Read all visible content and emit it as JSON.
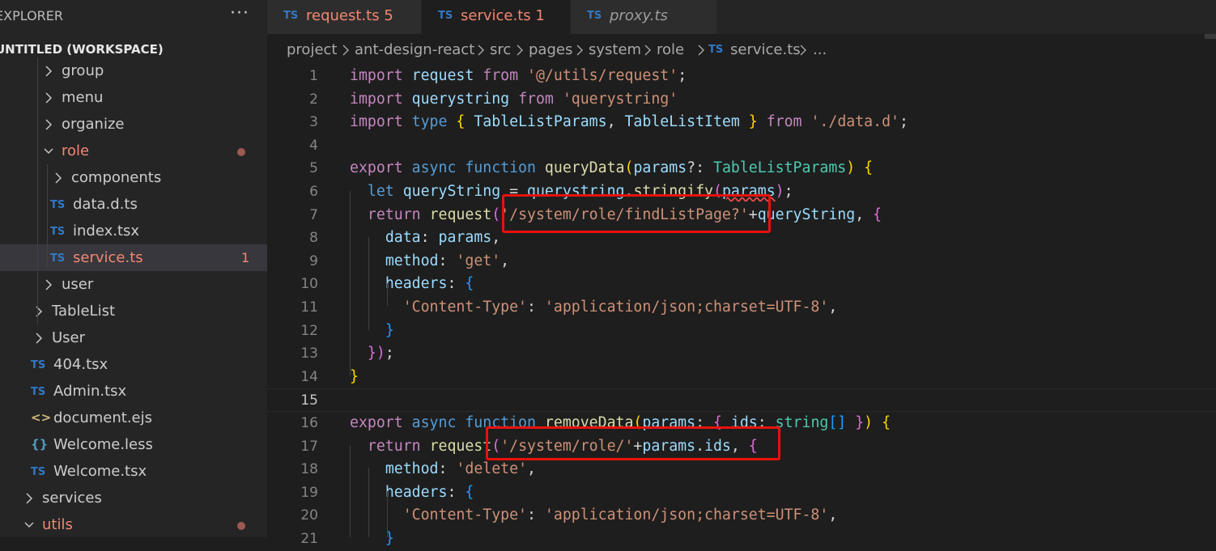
{
  "explorer": {
    "title": "EXPLORER",
    "more": "···",
    "workspace": "UNTITLED (WORKSPACE)",
    "items": [
      {
        "label": "group",
        "kind": "folder",
        "expanded": false
      },
      {
        "label": "menu",
        "kind": "folder",
        "expanded": false
      },
      {
        "label": "organize",
        "kind": "folder",
        "expanded": false
      },
      {
        "label": "role",
        "kind": "folder",
        "expanded": true,
        "modified": true
      },
      {
        "label": "components",
        "kind": "folder",
        "expanded": false
      },
      {
        "label": "data.d.ts",
        "kind": "ts",
        "icon": "TS"
      },
      {
        "label": "index.tsx",
        "kind": "ts",
        "icon": "TS"
      },
      {
        "label": "service.ts",
        "kind": "ts",
        "icon": "TS",
        "problems": "1",
        "selected": true
      },
      {
        "label": "user",
        "kind": "folder",
        "expanded": false
      },
      {
        "label": "TableList",
        "kind": "folder",
        "expanded": false
      },
      {
        "label": "User",
        "kind": "folder",
        "expanded": false
      },
      {
        "label": "404.tsx",
        "kind": "ts",
        "icon": "TS"
      },
      {
        "label": "Admin.tsx",
        "kind": "ts",
        "icon": "TS"
      },
      {
        "label": "document.ejs",
        "kind": "ejs",
        "icon": "<>"
      },
      {
        "label": "Welcome.less",
        "kind": "less",
        "icon": "{}"
      },
      {
        "label": "Welcome.tsx",
        "kind": "ts",
        "icon": "TS"
      },
      {
        "label": "services",
        "kind": "folder",
        "expanded": false
      },
      {
        "label": "utils",
        "kind": "folder",
        "expanded": true,
        "modified": true
      }
    ]
  },
  "tabs": [
    {
      "icon": "TS",
      "label": "request.ts",
      "badge": "5",
      "active": false
    },
    {
      "icon": "TS",
      "label": "service.ts",
      "badge": "1",
      "active": true,
      "close": "×"
    },
    {
      "icon": "TS",
      "label": "proxy.ts",
      "badge": "",
      "active": false
    }
  ],
  "breadcrumb": {
    "parts": [
      "project",
      "ant-design-react",
      "src",
      "pages",
      "system",
      "role"
    ],
    "file_icon": "TS",
    "file": "service.ts",
    "ellipsis": "..."
  },
  "colors": {
    "keyword": "#c586c0",
    "storage": "#569cd6",
    "function": "#dcdcaa",
    "variable": "#9cdcfe",
    "type": "#4ec9b0",
    "string": "#ce9178",
    "highlight_box": "#e8120c",
    "error": "#f48771"
  },
  "code": {
    "line_numbers": [
      "1",
      "2",
      "3",
      "4",
      "5",
      "6",
      "7",
      "8",
      "9",
      "10",
      "11",
      "12",
      "13",
      "14",
      "15",
      "16",
      "17",
      "18",
      "19",
      "20",
      "21"
    ],
    "lines": [
      [
        [
          "kw",
          "import"
        ],
        [
          "p",
          " "
        ],
        [
          "var",
          "request"
        ],
        [
          "p",
          " "
        ],
        [
          "kw",
          "from"
        ],
        [
          "p",
          " "
        ],
        [
          "str",
          "'@/utils/request'"
        ],
        [
          "p",
          ";"
        ]
      ],
      [
        [
          "kw",
          "import"
        ],
        [
          "p",
          " "
        ],
        [
          "var",
          "querystring"
        ],
        [
          "p",
          " "
        ],
        [
          "kw",
          "from"
        ],
        [
          "p",
          " "
        ],
        [
          "str",
          "'querystring'"
        ]
      ],
      [
        [
          "kw",
          "import"
        ],
        [
          "p",
          " "
        ],
        [
          "decl",
          "type"
        ],
        [
          "p",
          " "
        ],
        [
          "br",
          "{"
        ],
        [
          "p",
          " "
        ],
        [
          "var",
          "TableListParams"
        ],
        [
          "p",
          ", "
        ],
        [
          "var",
          "TableListItem"
        ],
        [
          "p",
          " "
        ],
        [
          "br",
          "}"
        ],
        [
          "p",
          " "
        ],
        [
          "kw",
          "from"
        ],
        [
          "p",
          " "
        ],
        [
          "str",
          "'./data.d'"
        ],
        [
          "p",
          ";"
        ]
      ],
      [],
      [
        [
          "kw",
          "export"
        ],
        [
          "p",
          " "
        ],
        [
          "decl",
          "async"
        ],
        [
          "p",
          " "
        ],
        [
          "decl",
          "function"
        ],
        [
          "p",
          " "
        ],
        [
          "fn",
          "queryData"
        ],
        [
          "br",
          "("
        ],
        [
          "var",
          "params"
        ],
        [
          "p",
          "?: "
        ],
        [
          "type",
          "TableListParams"
        ],
        [
          "br",
          ")"
        ],
        [
          "p",
          " "
        ],
        [
          "br",
          "{"
        ]
      ],
      [
        [
          "p",
          "  "
        ],
        [
          "decl",
          "let"
        ],
        [
          "p",
          " "
        ],
        [
          "var",
          "queryString"
        ],
        [
          "p",
          " = "
        ],
        [
          "var",
          "querystring"
        ],
        [
          "p",
          "."
        ],
        [
          "fn",
          "stringify"
        ],
        [
          "br2",
          "("
        ],
        [
          "var",
          "params",
          "sq"
        ],
        [
          "br2",
          ")"
        ],
        [
          "p",
          ";"
        ]
      ],
      [
        [
          "p",
          "  "
        ],
        [
          "kw",
          "return"
        ],
        [
          "p",
          " "
        ],
        [
          "fn",
          "request"
        ],
        [
          "br2",
          "("
        ],
        [
          "str",
          "'/system/role/findListPage?'"
        ],
        [
          "p",
          "+"
        ],
        [
          "var",
          "queryString"
        ],
        [
          "p",
          ", "
        ],
        [
          "br2",
          "{"
        ]
      ],
      [
        [
          "p",
          "    "
        ],
        [
          "var",
          "data"
        ],
        [
          "p",
          ": "
        ],
        [
          "var",
          "params"
        ],
        [
          "p",
          ","
        ]
      ],
      [
        [
          "p",
          "    "
        ],
        [
          "var",
          "method"
        ],
        [
          "p",
          ": "
        ],
        [
          "str",
          "'get'"
        ],
        [
          "p",
          ","
        ]
      ],
      [
        [
          "p",
          "    "
        ],
        [
          "var",
          "headers"
        ],
        [
          "p",
          ": "
        ],
        [
          "br3",
          "{"
        ]
      ],
      [
        [
          "p",
          "      "
        ],
        [
          "str",
          "'Content-Type'"
        ],
        [
          "p",
          ": "
        ],
        [
          "str",
          "'application/json;charset=UTF-8'"
        ],
        [
          "p",
          ","
        ]
      ],
      [
        [
          "p",
          "    "
        ],
        [
          "br3",
          "}"
        ]
      ],
      [
        [
          "p",
          "  "
        ],
        [
          "br2",
          "}"
        ],
        [
          "br2",
          ")"
        ],
        [
          "p",
          ";"
        ]
      ],
      [
        [
          "br",
          "}"
        ]
      ],
      [],
      [
        [
          "kw",
          "export"
        ],
        [
          "p",
          " "
        ],
        [
          "decl",
          "async"
        ],
        [
          "p",
          " "
        ],
        [
          "decl",
          "function"
        ],
        [
          "p",
          " "
        ],
        [
          "fn",
          "removeData"
        ],
        [
          "br",
          "("
        ],
        [
          "var",
          "params"
        ],
        [
          "p",
          ": "
        ],
        [
          "br2",
          "{"
        ],
        [
          "p",
          " "
        ],
        [
          "var",
          "ids"
        ],
        [
          "p",
          ": "
        ],
        [
          "type",
          "string"
        ],
        [
          "br3",
          "[]"
        ],
        [
          "p",
          " "
        ],
        [
          "br2",
          "}"
        ],
        [
          "br",
          ")"
        ],
        [
          "p",
          " "
        ],
        [
          "br",
          "{"
        ]
      ],
      [
        [
          "p",
          "  "
        ],
        [
          "kw",
          "return"
        ],
        [
          "p",
          " "
        ],
        [
          "fn",
          "request"
        ],
        [
          "br2",
          "("
        ],
        [
          "str",
          "'/system/role/'"
        ],
        [
          "p",
          "+"
        ],
        [
          "var",
          "params"
        ],
        [
          "p",
          "."
        ],
        [
          "var",
          "ids"
        ],
        [
          "p",
          ", "
        ],
        [
          "br2",
          "{"
        ]
      ],
      [
        [
          "p",
          "    "
        ],
        [
          "var",
          "method"
        ],
        [
          "p",
          ": "
        ],
        [
          "str",
          "'delete'"
        ],
        [
          "p",
          ","
        ]
      ],
      [
        [
          "p",
          "    "
        ],
        [
          "var",
          "headers"
        ],
        [
          "p",
          ": "
        ],
        [
          "br3",
          "{"
        ]
      ],
      [
        [
          "p",
          "      "
        ],
        [
          "str",
          "'Content-Type'"
        ],
        [
          "p",
          ": "
        ],
        [
          "str",
          "'application/json;charset=UTF-8'"
        ],
        [
          "p",
          ","
        ]
      ],
      [
        [
          "p",
          "    "
        ],
        [
          "br3",
          "}"
        ]
      ]
    ]
  }
}
